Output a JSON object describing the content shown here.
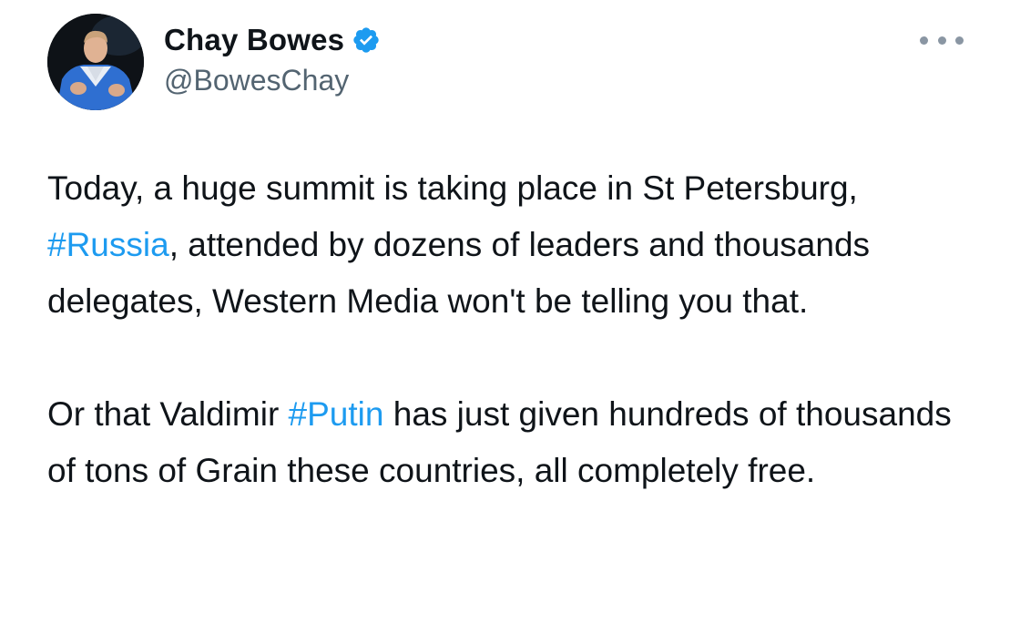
{
  "author": {
    "name": "Chay Bowes",
    "handle": "@BowesChay",
    "verified": true,
    "avatar_icon": "avatar-photo"
  },
  "menu": {
    "icon": "more-horizontal-icon"
  },
  "colors": {
    "hashtag": "#1d9bf0",
    "verified_badge": "#1d9bf0",
    "text": "#0f1419",
    "secondary": "#536471"
  },
  "tweet": {
    "paragraph1": {
      "text_before": "Today, a huge summit is taking place in St Petersburg, ",
      "hashtag": "#Russia",
      "text_after": ", attended by dozens of leaders and thousands delegates, Western Media won't be telling you that."
    },
    "paragraph2": {
      "text_before": "Or that Valdimir ",
      "hashtag": "#Putin",
      "text_after": " has just given hundreds of thousands of tons of Grain these countries, all completely free."
    }
  }
}
